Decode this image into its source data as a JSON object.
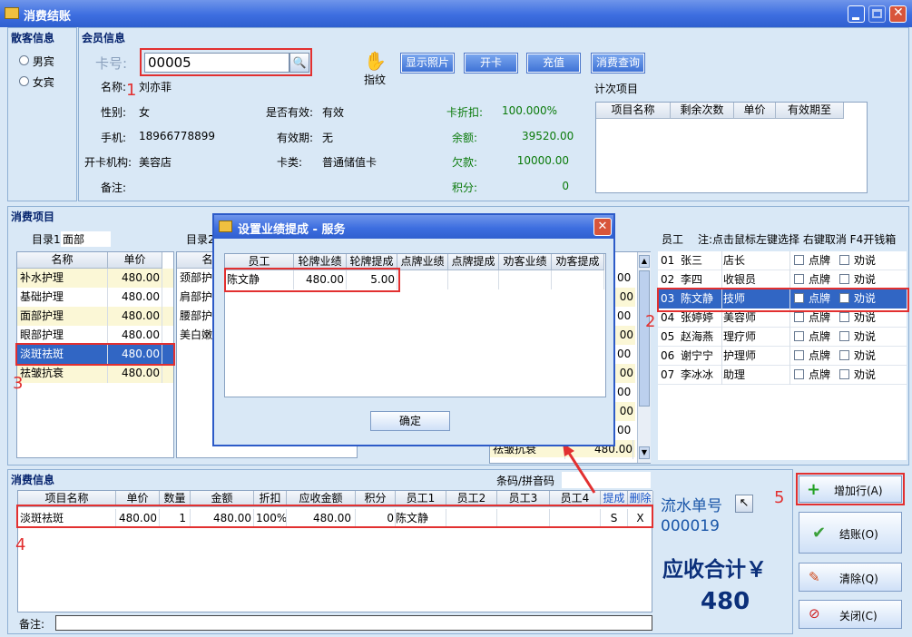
{
  "window": {
    "title": "消费结账"
  },
  "guest": {
    "title": "散客信息",
    "male": "男宾",
    "female": "女宾"
  },
  "member": {
    "title": "会员信息",
    "card_label": "卡号:",
    "card_no": "00005",
    "fingerprint": "指纹",
    "buttons": {
      "photo": "显示照片",
      "open_card": "开卡",
      "recharge": "充值",
      "query": "消费查询"
    },
    "name_label": "名称:",
    "name": "刘亦菲",
    "gender_label": "性别:",
    "gender": "女",
    "valid_label": "是否有效:",
    "valid": "有效",
    "phone_label": "手机:",
    "phone": "18966778899",
    "expire_label": "有效期:",
    "expire": "无",
    "org_label": "开卡机构:",
    "org": "美容店",
    "type_label": "卡类:",
    "type": "普通储值卡",
    "remark_label": "备注:",
    "discount_label": "卡折扣:",
    "discount": "100.000%",
    "balance_label": "余额:",
    "balance": "39520.00",
    "debt_label": "欠款:",
    "debt": "10000.00",
    "points_label": "积分:",
    "points": "0",
    "count_items": {
      "title": "计次项目",
      "cols": [
        "项目名称",
        "剩余次数",
        "单价",
        "有效期至"
      ]
    }
  },
  "items": {
    "title": "消费项目",
    "dir1_label": "目录1",
    "dir1": "面部",
    "dir2_label": "目录2",
    "cols": [
      "名称",
      "单价"
    ],
    "list1": [
      [
        "补水护理",
        "480.00"
      ],
      [
        "基础护理",
        "480.00"
      ],
      [
        "面部护理",
        "480.00"
      ],
      [
        "眼部护理",
        "480.00"
      ],
      [
        "淡斑祛斑",
        "480.00"
      ],
      [
        "祛皱抗衰",
        "480.00"
      ]
    ],
    "list2": [
      [
        "颈部护理"
      ],
      [
        "肩部护理"
      ],
      [
        "腰部护理"
      ],
      [
        "美白嫩肤"
      ]
    ],
    "list3": [
      [
        "00"
      ],
      [
        "00"
      ],
      [
        "00"
      ],
      [
        "00"
      ],
      [
        "00"
      ],
      [
        "00"
      ],
      [
        "00"
      ],
      [
        "00"
      ],
      [
        "00"
      ],
      [
        "00"
      ],
      [
        "祛皱抗衰",
        "480.00"
      ]
    ]
  },
  "staff": {
    "label": "员工",
    "note": "注:点击鼠标左键选择 右键取消 F4开钱箱",
    "brand": "点牌",
    "persuade": "劝说",
    "rows": [
      [
        "01",
        "张三",
        "店长"
      ],
      [
        "02",
        "李四",
        "收银员"
      ],
      [
        "03",
        "陈文静",
        "技师"
      ],
      [
        "04",
        "张婷婷",
        "美容师"
      ],
      [
        "05",
        "赵海燕",
        "理疗师"
      ],
      [
        "06",
        "谢宁宁",
        "护理师"
      ],
      [
        "07",
        "李冰冰",
        "助理"
      ]
    ]
  },
  "consume": {
    "title": "消费信息",
    "barcode_label": "条码/拼音码",
    "cols": [
      "项目名称",
      "单价",
      "数量",
      "金额",
      "折扣",
      "应收金额",
      "积分",
      "员工1",
      "员工2",
      "员工3",
      "员工4",
      "提成",
      "删除"
    ],
    "row": [
      "淡斑祛斑",
      "480.00",
      "1",
      "480.00",
      "100%",
      "480.00",
      "0",
      "陈文静",
      "",
      "",
      "",
      "S",
      "X"
    ],
    "remark_label": "备注:"
  },
  "summary": {
    "serial_label": "流水单号",
    "serial": "000019",
    "total_label": "应收合计￥",
    "total": "480"
  },
  "actions": {
    "add": "增加行(A)",
    "checkout": "结账(O)",
    "clear": "清除(Q)",
    "close": "关闭(C)"
  },
  "dialog": {
    "title": "设置业绩提成 - 服务",
    "cols": [
      "员工",
      "轮牌业绩",
      "轮牌提成",
      "点牌业绩",
      "点牌提成",
      "劝客业绩",
      "劝客提成"
    ],
    "row": [
      "陈文静",
      "480.00",
      "5.00",
      "",
      "",
      "",
      ""
    ],
    "ok": "确定"
  },
  "annotations": [
    "1",
    "2",
    "3",
    "4",
    "5"
  ]
}
